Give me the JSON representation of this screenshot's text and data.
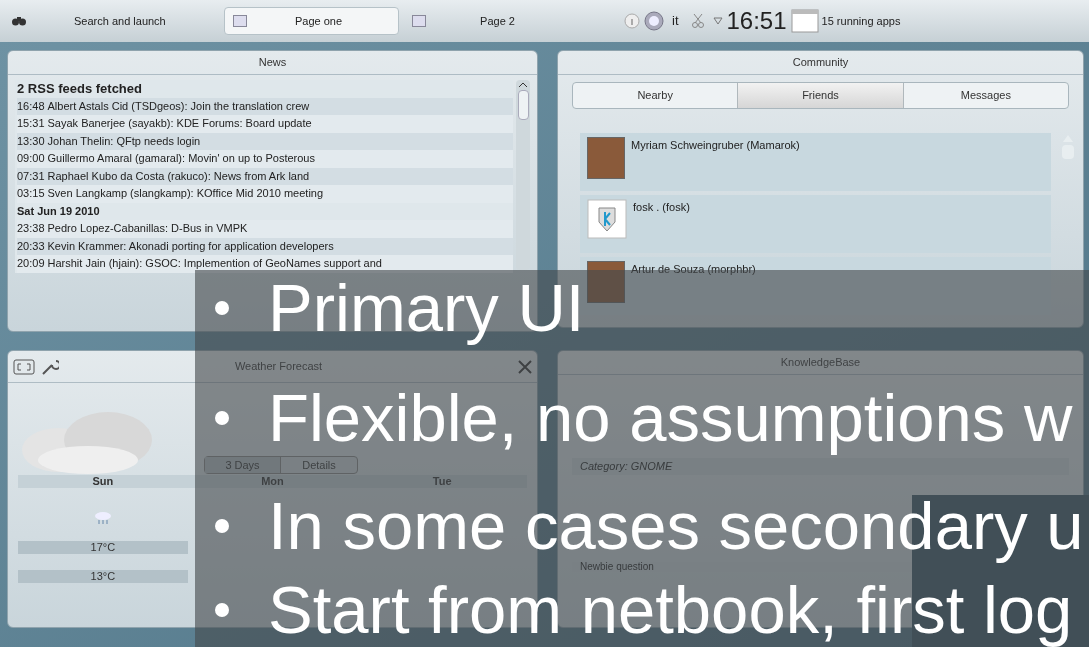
{
  "top_bar": {
    "launcher": "Search and launch",
    "pages": [
      {
        "label": "Page one",
        "selected": true
      },
      {
        "label": "Page 2",
        "selected": false
      }
    ],
    "language": "it",
    "clock": "16:51",
    "tasks": "15 running apps"
  },
  "news": {
    "title": "News",
    "items": [
      {
        "kind": "heading",
        "text": "2 RSS feeds fetched"
      },
      {
        "kind": "entry",
        "time": "16:48",
        "text": "Albert Astals Cid (TSDgeos): Join the translation crew"
      },
      {
        "kind": "entry",
        "time": "15:31",
        "text": "Sayak Banerjee (sayakb): KDE Forums: Board update"
      },
      {
        "kind": "entry",
        "time": "13:30",
        "text": "Johan Thelin: QFtp needs login"
      },
      {
        "kind": "entry",
        "time": "09:00",
        "text": "Guillermo Amaral (gamaral): Movin' on up to Posterous"
      },
      {
        "kind": "entry",
        "time": "07:31",
        "text": "Raphael Kubo da Costa (rakuco): News from Ark land"
      },
      {
        "kind": "entry",
        "time": "03:15",
        "text": "Sven Langkamp (slangkamp): KOffice Mid 2010 meeting"
      },
      {
        "kind": "heading",
        "text": "Sat Jun 19 2010"
      },
      {
        "kind": "entry",
        "time": "23:38",
        "text": "Pedro Lopez-Cabanillas: D-Bus in VMPK"
      },
      {
        "kind": "entry",
        "time": "20:33",
        "text": "Kevin Krammer: Akonadi porting for application developers"
      },
      {
        "kind": "entry",
        "time": "20:09",
        "text": "Harshit Jain (hjain): GSOC: Implemention of GeoNames support and"
      }
    ]
  },
  "community": {
    "title": "Community",
    "tabs": [
      {
        "label": "Nearby",
        "selected": false
      },
      {
        "label": "Friends",
        "selected": true
      },
      {
        "label": "Messages",
        "selected": false
      }
    ],
    "friends": [
      {
        "name": "Myriam Schweingruber (Mamarok)",
        "kind": "photo"
      },
      {
        "name": "fosk . (fosk)",
        "kind": "logo"
      },
      {
        "name": "Artur de Souza (morphbr)",
        "kind": "photo"
      }
    ]
  },
  "weather": {
    "title": "Weather Forecast",
    "tabs": [
      {
        "label": "3 Days",
        "selected": true
      },
      {
        "label": "Details",
        "selected": false
      }
    ],
    "days": [
      {
        "name": "Sun",
        "kind": "rain",
        "high": "17°C",
        "low": "13°C"
      },
      {
        "name": "Mon"
      },
      {
        "name": "Tue"
      }
    ]
  },
  "knowledgebase": {
    "title": "KnowledgeBase",
    "items": [
      {
        "category": "Category: GNOME"
      },
      {
        "title": "Newbie question"
      }
    ]
  },
  "slide": {
    "bullets": [
      "Primary UI",
      "Flexible, no assumptions w",
      "In some cases secondary u",
      "Start from netbook, first log"
    ]
  }
}
